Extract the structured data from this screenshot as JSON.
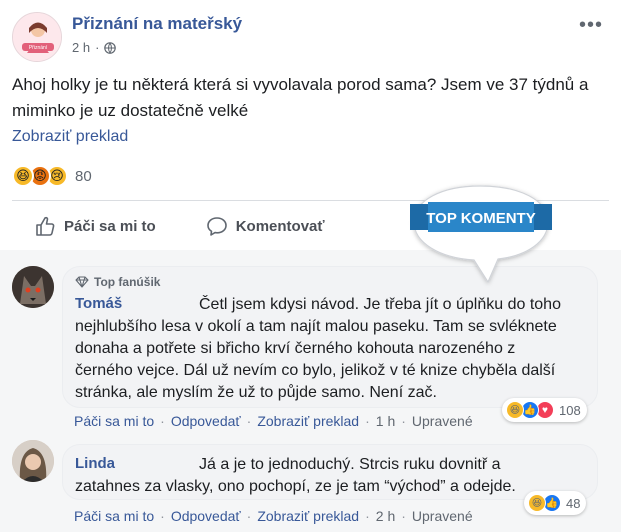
{
  "post": {
    "page_name": "Přiznání na mateřský",
    "time": "2 h",
    "text": "Ahoj holky je tu některá která si vyvolavala porod sama? Jsem ve 37 týdnů a miminko je uz dostatečně velké",
    "translate": "Zobraziť preklad",
    "reaction_count": "80",
    "reactions": [
      "haha",
      "angry",
      "sad"
    ]
  },
  "actions": {
    "like": "Páči sa mi to",
    "comment": "Komentovať"
  },
  "banner": {
    "label": "TOP KOMENTY"
  },
  "comments": [
    {
      "badge": "Top fanúšik",
      "author": "Tomáš",
      "lines": [
        "Četl jsem kdysi návod. Je třeba jít o úplňku do toho",
        "nejhlubšího lesa v okolí a tam najít malou paseku. Tam se svléknete",
        "donaha a potřete si břicho krví černého kohouta narozeného z",
        "černého vejce. Dál už nevím co bylo, jelikož v té knize chyběla další",
        "stránka, ale myslím že už to půjde samo. Není zač."
      ],
      "like": "Páči sa mi to",
      "reply": "Odpovedať",
      "translate": "Zobraziť preklad",
      "time": "1 h",
      "edited": "Upravené",
      "reaction_count": "108"
    },
    {
      "author": "Linda",
      "lines": [
        "Já a je to jednoduchý. Strcis ruku dovnitř a",
        "zatahnes za vlasky, ono pochopí, ze je tam “východ” a odejde."
      ],
      "like": "Páči sa mi to",
      "reply": "Odpovedať",
      "translate": "Zobraziť preklad",
      "time": "2 h",
      "edited": "Upravené",
      "reaction_count": "48"
    }
  ],
  "colors": {
    "link": "#385898",
    "banner": "#2a86c9",
    "like_blue": "#1877f2",
    "love_red": "#f33e58",
    "haha_yellow": "#f7b928"
  }
}
